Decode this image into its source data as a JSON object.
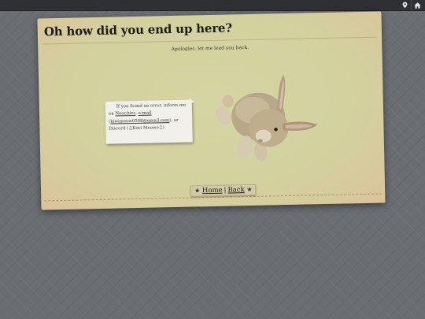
{
  "topbar": {
    "icons": [
      "map-pin-icon",
      "home-icon"
    ]
  },
  "card": {
    "title": "Oh how did you end up here?",
    "apology": "Apologies, let me lead you back."
  },
  "note": {
    "text_1": "If you found an error, inform me on ",
    "neocities_link": "Neocities",
    "text_2": ", ",
    "email_link": "e-mail",
    "text_3": " (",
    "email_address": "kiwimeow0508@gmail.com",
    "text_4": "), or Discord (♫Kiwi Meowe♫)"
  },
  "nav": {
    "star_left": "★",
    "home_label": "Home",
    "separator": "|",
    "back_label": "Back",
    "star_right": "★"
  },
  "colors": {
    "background": "#6a6e72",
    "card": "#d3d29f",
    "topbar": "#2e3034"
  }
}
